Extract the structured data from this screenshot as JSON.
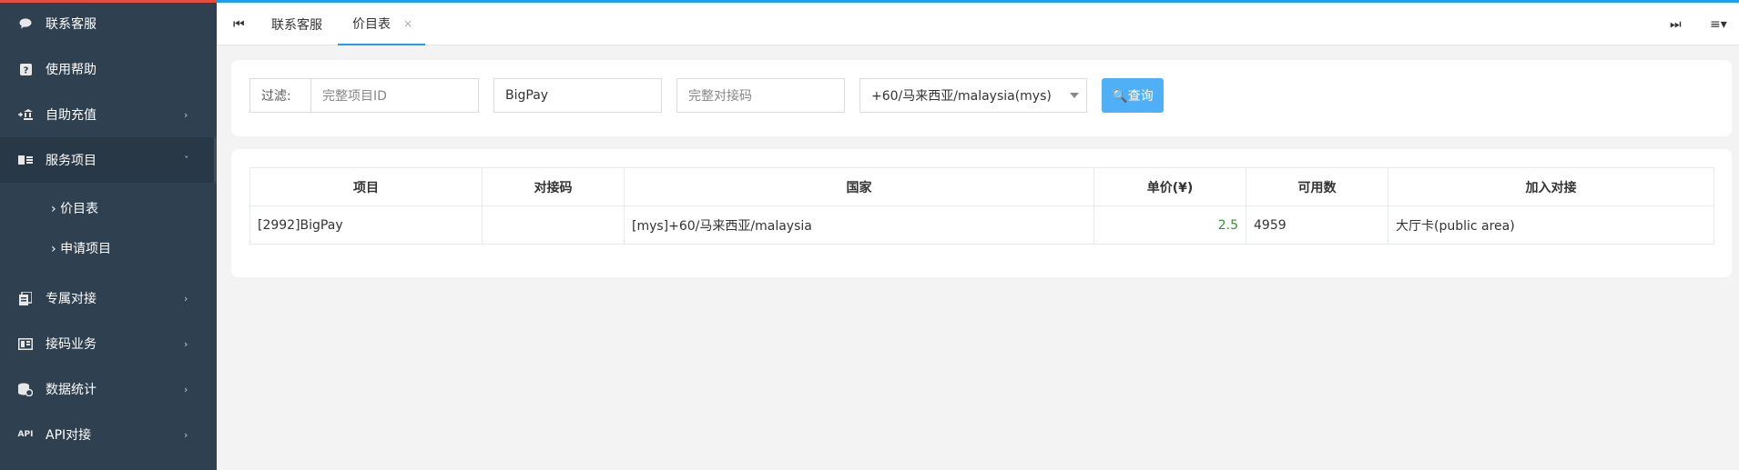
{
  "sidebar": {
    "items": [
      {
        "label": "联系客服",
        "icon": "chat-icon"
      },
      {
        "label": "使用帮助",
        "icon": "help-icon"
      },
      {
        "label": "自助充值",
        "icon": "recharge-icon",
        "arrow": "›"
      },
      {
        "label": "服务项目",
        "icon": "service-icon",
        "arrow": "ˇ"
      },
      {
        "label": "专属对接",
        "icon": "dedicated-icon",
        "arrow": "›"
      },
      {
        "label": "接码业务",
        "icon": "sms-code-icon",
        "arrow": "›"
      },
      {
        "label": "数据统计",
        "icon": "stats-icon",
        "arrow": "›"
      },
      {
        "label": "API对接",
        "icon": "api-icon",
        "icon_text": "API",
        "arrow": "›"
      }
    ],
    "sub_items": [
      {
        "label": "价目表",
        "chevron": "›"
      },
      {
        "label": "申请项目",
        "chevron": "›"
      }
    ]
  },
  "tabs": {
    "prev_icon": "⏮",
    "next_icon": "⏭",
    "menu_icon": "≡▾",
    "items": [
      {
        "label": "联系客服"
      },
      {
        "label": "价目表",
        "close": "×"
      }
    ]
  },
  "filter": {
    "label": "过滤:",
    "project_id_placeholder": "完整项目ID",
    "project_name_value": "BigPay",
    "code_placeholder": "完整对接码",
    "country_selected": "+60/马来西亚/malaysia(mys)",
    "query_button": "🔍查询"
  },
  "table": {
    "headers": [
      "项目",
      "对接码",
      "国家",
      "单价(¥)",
      "可用数",
      "加入对接"
    ],
    "rows": [
      [
        "[2992]BigPay",
        "",
        "[mys]+60/马来西亚/malaysia",
        "2.5",
        "4959",
        "大厅卡(public area)"
      ]
    ]
  },
  "colors": {
    "sidebar_bg": "#2f4050",
    "accent_blue": "#1e9ff2",
    "button_blue": "#4fb0f7",
    "price_green": "#2a9a2a",
    "top_red": "#e74c3c"
  }
}
